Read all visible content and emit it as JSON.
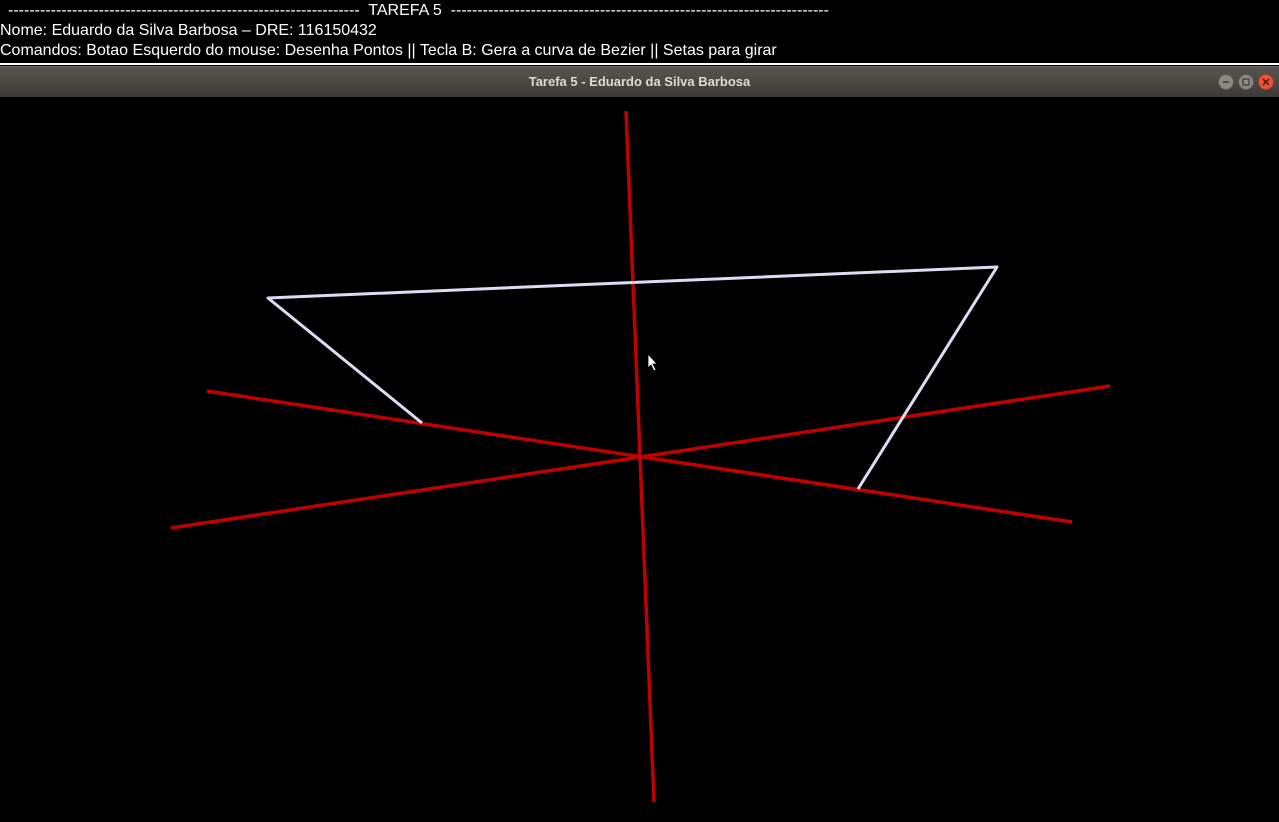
{
  "terminal": {
    "header_line": "------------------------------------------------------------------  TAREFA 5  -----------------------------------------------------------------------",
    "name_line": "Nome: Eduardo da Silva Barbosa – DRE: 116150432",
    "commands_line": "Comandos: Botao Esquerdo do mouse: Desenha Pontos || Tecla B: Gera a curva de Bezier || Setas para girar"
  },
  "window": {
    "title": "Tarefa 5 - Eduardo da Silva Barbosa",
    "buttons": {
      "minimize": "minimize-icon",
      "maximize": "maximize-icon",
      "close": "close-icon"
    }
  },
  "colors": {
    "axis": "#c00000",
    "control_polygon": "#dcdcf5",
    "background": "#000000"
  }
}
